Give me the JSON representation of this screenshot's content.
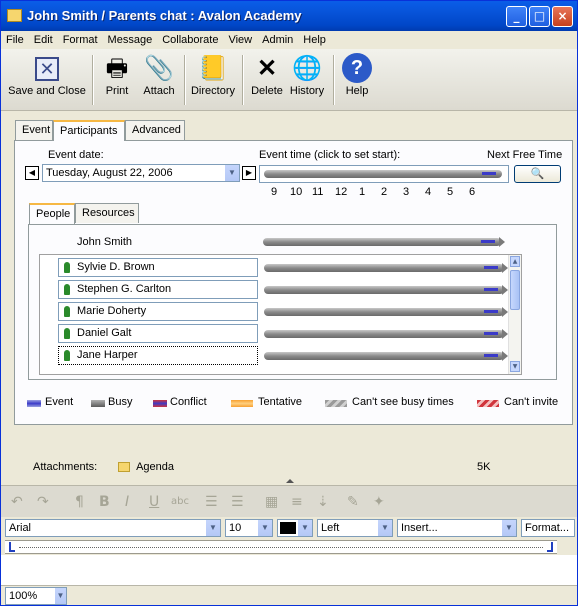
{
  "window": {
    "title": "John Smith / Parents chat : Avalon Academy"
  },
  "menu": [
    "File",
    "Edit",
    "Format",
    "Message",
    "Collaborate",
    "View",
    "Admin",
    "Help"
  ],
  "toolbar": {
    "save_close": "Save and Close",
    "print": "Print",
    "attach": "Attach",
    "directory": "Directory",
    "delete": "Delete",
    "history": "History",
    "help": "Help"
  },
  "tabs": {
    "event": "Event",
    "participants": "Participants",
    "advanced": "Advanced"
  },
  "schedule": {
    "event_date_label": "Event date:",
    "event_date_value": "Tuesday, August 22, 2006",
    "event_time_label": "Event time (click to set start):",
    "next_free_label": "Next Free Time",
    "hours": [
      "9",
      "10",
      "11",
      "12",
      "1",
      "2",
      "3",
      "4",
      "5",
      "6"
    ]
  },
  "subtabs": {
    "people": "People",
    "resources": "Resources"
  },
  "organizer": "John Smith",
  "participants": [
    "Sylvie D. Brown",
    "Stephen G. Carlton",
    "Marie Doherty",
    "Daniel Galt",
    "Jane Harper"
  ],
  "legend": [
    {
      "label": "Event",
      "color": "#3b3bc8"
    },
    {
      "label": "Busy",
      "color": "#6a6a6a"
    },
    {
      "label": "Conflict",
      "color": "#d0343c"
    },
    {
      "label": "Tentative",
      "color": "#f7a030"
    },
    {
      "label": "Can't see busy times",
      "color": "#9a9a9a"
    },
    {
      "label": "Can't invite",
      "color": "#d0343c"
    }
  ],
  "attachments": {
    "label": "Attachments:",
    "file": "Agenda",
    "size": "5K"
  },
  "format": {
    "font": "Arial",
    "size": "10",
    "align": "Left",
    "insert": "Insert...",
    "format": "Format..."
  },
  "status": {
    "zoom": "100%"
  }
}
